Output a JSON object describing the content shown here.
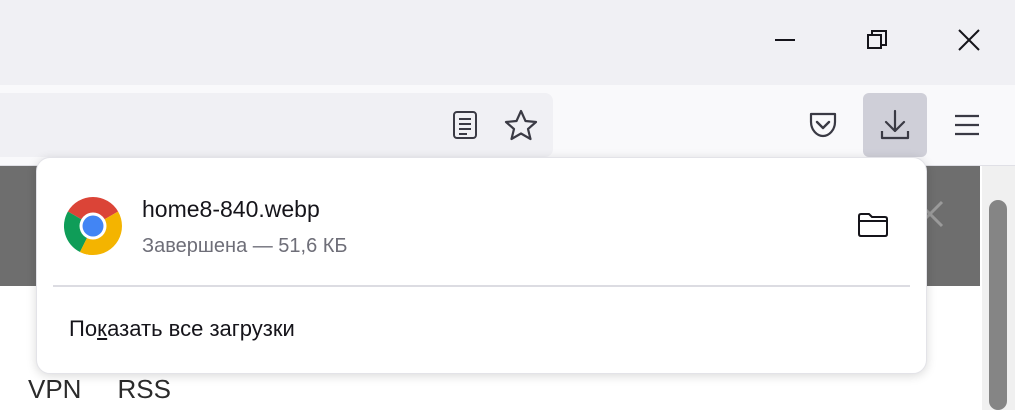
{
  "window_controls": {
    "minimize_icon": "minimize-icon",
    "restore_icon": "restore-icon",
    "close_icon": "close-icon"
  },
  "toolbar": {
    "reader_view_icon": "reader-view-icon",
    "bookmark_icon": "star-icon",
    "pocket_icon": "pocket-icon",
    "downloads_icon": "download-icon",
    "menu_icon": "hamburger-menu-icon"
  },
  "downloads_panel": {
    "items": [
      {
        "file_name": "home8-840.webp",
        "status": "Завершена — 51,6 КБ",
        "icon": "chrome-icon",
        "action_icon": "folder-icon"
      }
    ],
    "show_all": {
      "before": "По",
      "accesskey": "к",
      "after": "азать все загрузки"
    }
  },
  "page": {
    "nav_links": [
      "VPN",
      "RSS"
    ],
    "banner_close_icon": "close-icon"
  },
  "colors": {
    "titlebar": "#f0f0f4",
    "toolbar": "#f9f9fb",
    "active_button": "#cfcfd8",
    "banner": "#6e6e6e"
  }
}
